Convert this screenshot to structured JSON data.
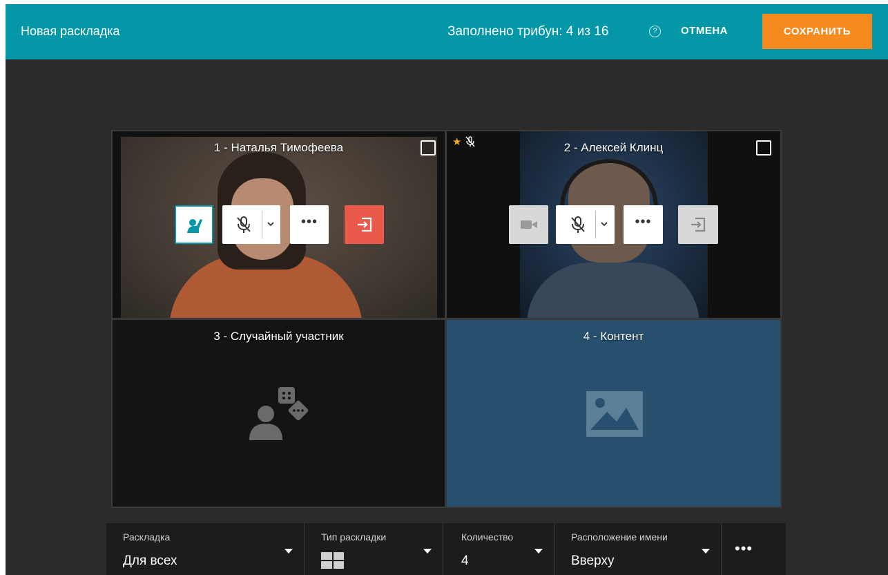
{
  "header": {
    "title": "Новая раскладка",
    "filled_status": "Заполнено трибун: 4 из 16",
    "help_glyph": "?",
    "cancel_label": "ОТМЕНА",
    "save_label": "СОХРАНИТЬ"
  },
  "tiles": [
    {
      "label": "1 - Наталья Тимофеева",
      "controls": [
        "raise-hand-icon",
        "mic-muted-icon",
        "chevron-down-icon",
        "more-icon",
        "exit-icon"
      ],
      "more_glyph": "•••"
    },
    {
      "label": "2 - Алексей Клинц",
      "badges": [
        "star-icon",
        "mic-muted-icon"
      ],
      "star_glyph": "★",
      "controls": [
        "camera-icon",
        "mic-muted-icon",
        "chevron-down-icon",
        "more-icon",
        "exit-icon"
      ],
      "more_glyph": "•••"
    },
    {
      "label": "3 - Случайный участник",
      "placeholder_icon": "random-participant-icon"
    },
    {
      "label": "4 - Контент",
      "placeholder_icon": "image-icon"
    }
  ],
  "bottombar": {
    "layout": {
      "label": "Раскладка",
      "value": "Для всех"
    },
    "layout_type": {
      "label": "Тип раскладки",
      "icon": "grid-2x2-icon"
    },
    "count": {
      "label": "Количество",
      "value": "4"
    },
    "name_position": {
      "label": "Расположение имени",
      "value": "Вверху"
    },
    "more_glyph": "•••"
  },
  "colors": {
    "header_bg": "#0397a7",
    "save_bg": "#f58a1f",
    "exit_active": "#ea5a4a",
    "content_tile": "#26506e",
    "star": "#f5a623"
  }
}
